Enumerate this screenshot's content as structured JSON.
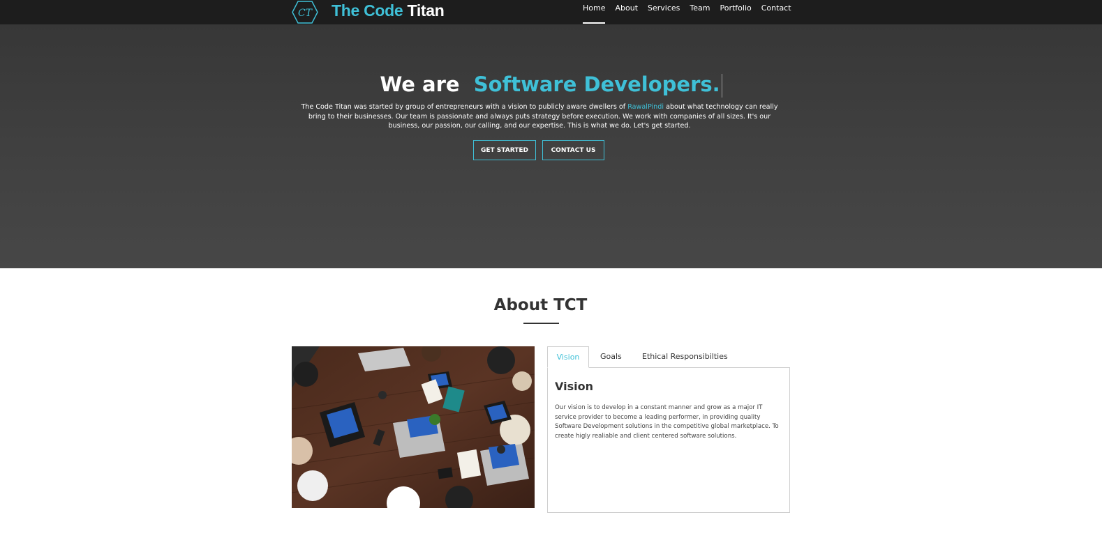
{
  "brand": {
    "logo_text": "CT",
    "name_part1": "The Code",
    "name_part2": "Titan"
  },
  "nav": {
    "items": [
      {
        "label": "Home",
        "active": true
      },
      {
        "label": "About",
        "active": false
      },
      {
        "label": "Services",
        "active": false
      },
      {
        "label": "Team",
        "active": false
      },
      {
        "label": "Portfolio",
        "active": false
      },
      {
        "label": "Contact",
        "active": false
      }
    ]
  },
  "hero": {
    "title_prefix": "We are",
    "title_accent": "Software Developers.",
    "text_before_link": "The Code Titan was started by group of entrepreneurs with a vision to publicly aware dwellers of ",
    "link_text": "RawalPindi",
    "text_after_link": " about what technology can really bring to their businesses. Our team is passionate and always puts strategy before execution. We work with companies of all sizes. It's our business, our passion, our calling, and our expertise. This is what we do. Let's get started.",
    "get_started_label": "GET STARTED",
    "contact_label": "CONTACT US"
  },
  "about": {
    "title": "About TCT",
    "tabs": [
      {
        "label": "Vision",
        "active": true
      },
      {
        "label": "Goals",
        "active": false
      },
      {
        "label": "Ethical Responsibilties",
        "active": false
      }
    ],
    "panel_title": "Vision",
    "panel_text": "Our vision is to develop in a constant manner and grow as a major IT service provider to become a leading performer, in providing quality Software Development solutions in the competitive global marketplace. To create higly realiable and client centered software solutions."
  },
  "colors": {
    "accent": "#3fc0d7",
    "navbar_bg": "#1d1d1d",
    "hero_bg": "#404040",
    "heading": "#333333"
  }
}
